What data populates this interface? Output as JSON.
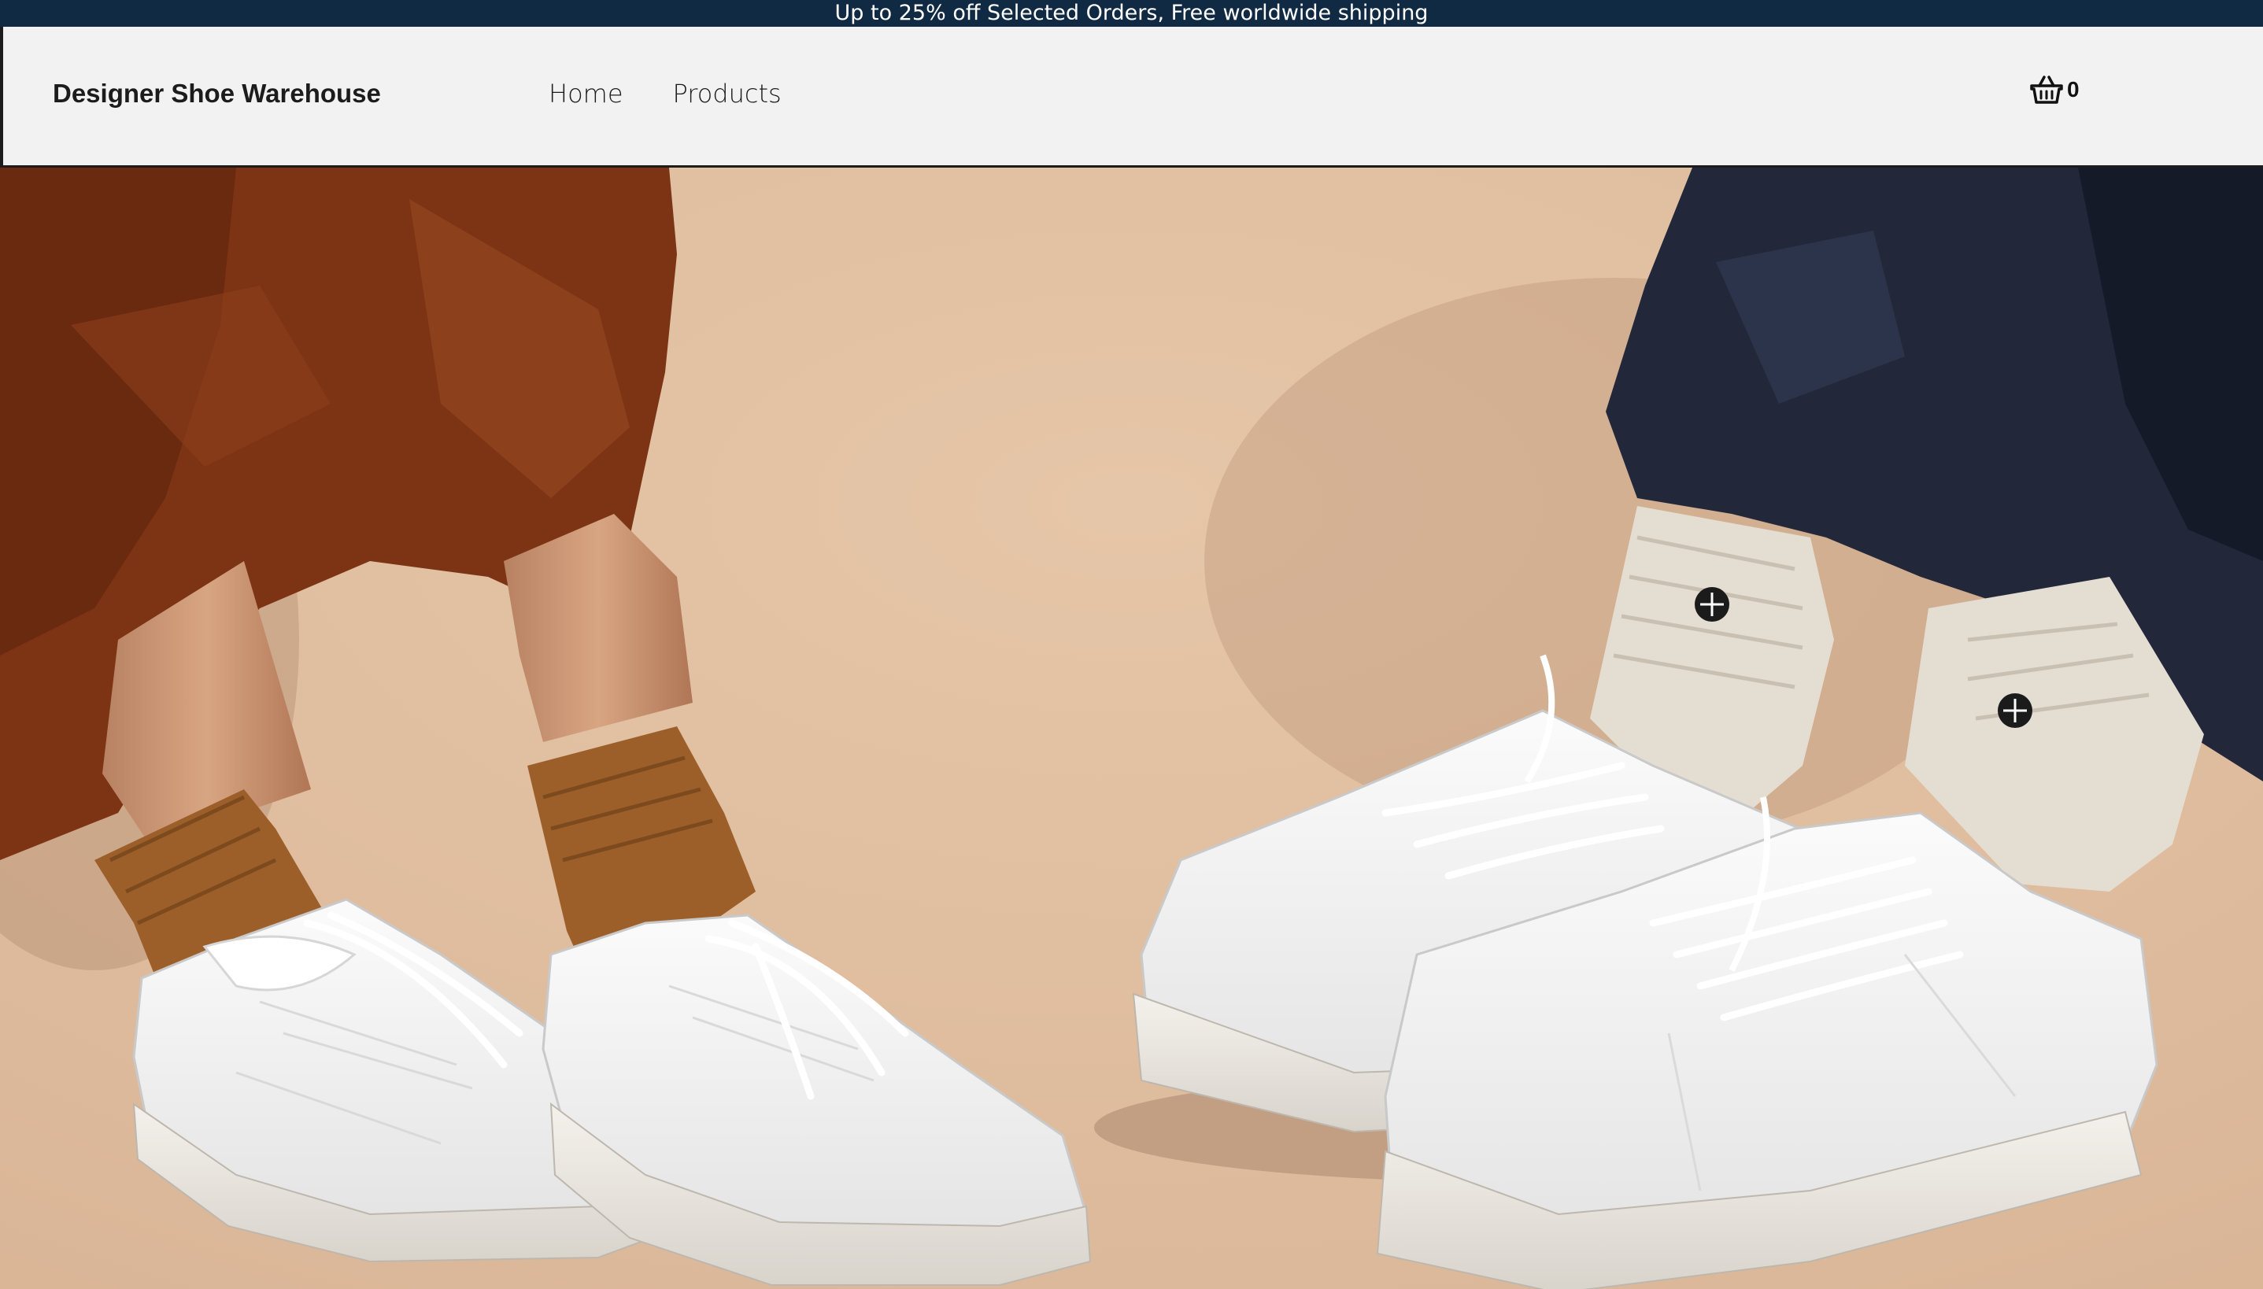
{
  "announcement": {
    "text": "Up to 25% off Selected Orders, Free worldwide shipping"
  },
  "header": {
    "brand": "Designer Shoe Warehouse",
    "nav": [
      {
        "label": "Home"
      },
      {
        "label": "Products"
      }
    ],
    "cart": {
      "icon": "basket-icon",
      "count": "0"
    }
  },
  "hero": {
    "image": "white-sneakers-hero-photo"
  },
  "colors": {
    "announcement_bg": "#112a44",
    "header_bg": "#f2f2f2",
    "hero_bg": "#e0bfa0"
  }
}
